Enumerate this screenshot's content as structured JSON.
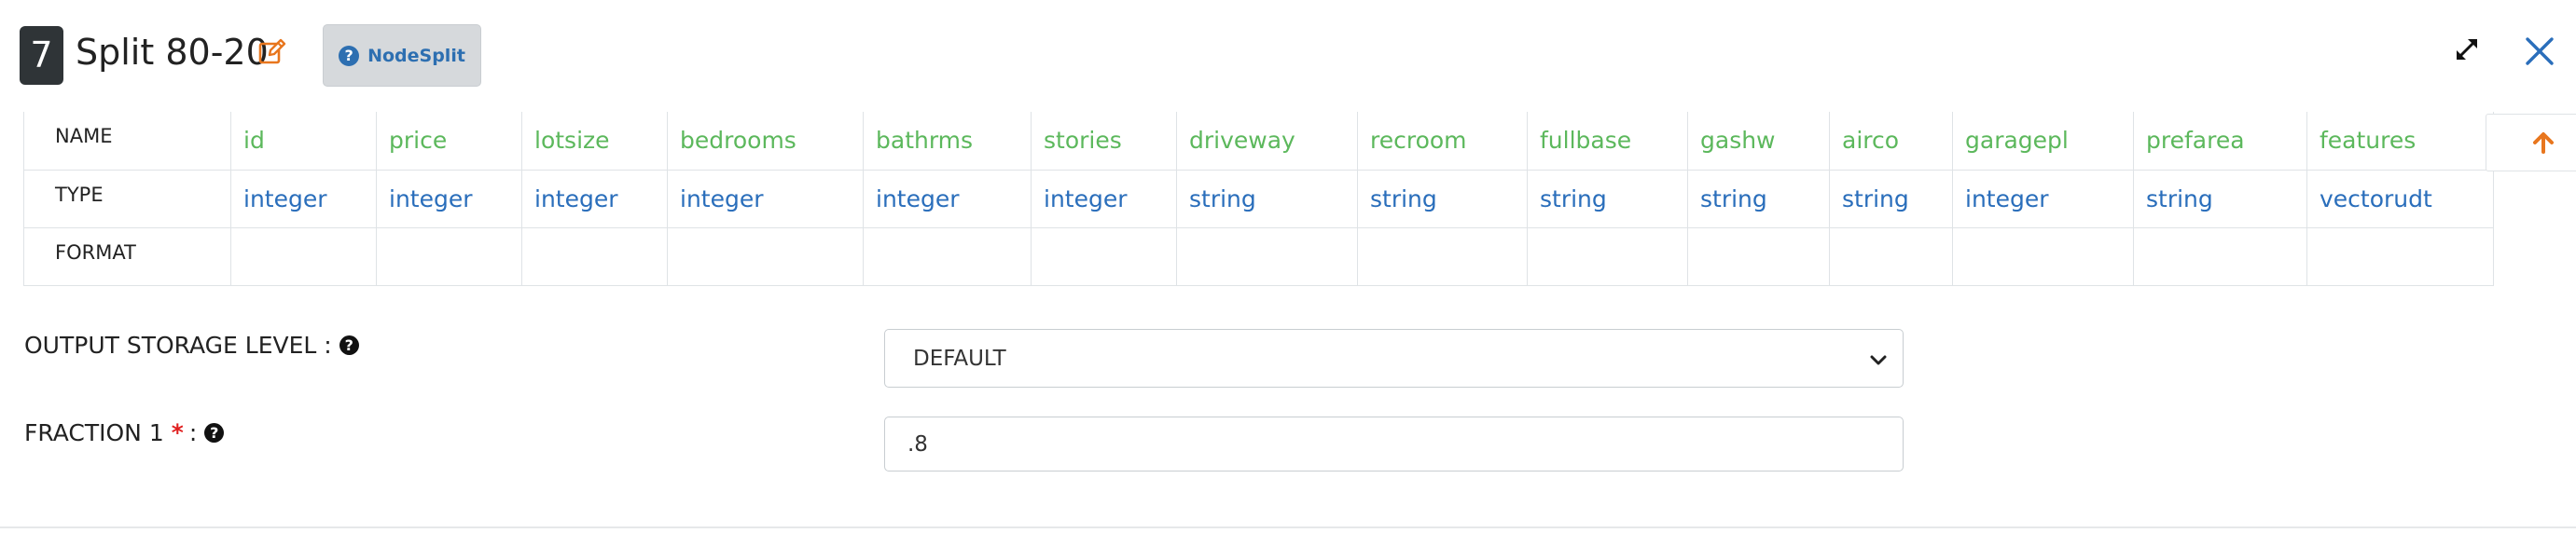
{
  "header": {
    "node_number": "7",
    "title": "Split 80-20",
    "node_type_label": "NodeSplit",
    "node_type_icon": "question-circle-icon",
    "edit_icon": "edit-icon",
    "expand_icon": "expand-icon",
    "close_icon": "close-icon"
  },
  "schema": {
    "row_labels": {
      "name": "NAME",
      "type": "TYPE",
      "format": "FORMAT"
    },
    "columns": [
      {
        "name": "id",
        "type": "integer",
        "format": ""
      },
      {
        "name": "price",
        "type": "integer",
        "format": ""
      },
      {
        "name": "lotsize",
        "type": "integer",
        "format": ""
      },
      {
        "name": "bedrooms",
        "type": "integer",
        "format": ""
      },
      {
        "name": "bathrms",
        "type": "integer",
        "format": ""
      },
      {
        "name": "stories",
        "type": "integer",
        "format": ""
      },
      {
        "name": "driveway",
        "type": "string",
        "format": ""
      },
      {
        "name": "recroom",
        "type": "string",
        "format": ""
      },
      {
        "name": "fullbase",
        "type": "string",
        "format": ""
      },
      {
        "name": "gashw",
        "type": "string",
        "format": ""
      },
      {
        "name": "airco",
        "type": "string",
        "format": ""
      },
      {
        "name": "garagepl",
        "type": "integer",
        "format": ""
      },
      {
        "name": "prefarea",
        "type": "string",
        "format": ""
      },
      {
        "name": "features",
        "type": "vectorudt",
        "format": ""
      }
    ],
    "scroll_icon": "arrow-up-icon"
  },
  "form": {
    "storage_level": {
      "label": "OUTPUT STORAGE LEVEL :",
      "value": "DEFAULT"
    },
    "fraction": {
      "label": "FRACTION 1",
      "required_mark": "*",
      "separator": ":",
      "value": ".8"
    }
  },
  "colors": {
    "accent_orange": "#e8761e",
    "link_blue": "#2a6ebb",
    "name_green": "#5cb85c",
    "badge_dark": "#2f3437"
  }
}
